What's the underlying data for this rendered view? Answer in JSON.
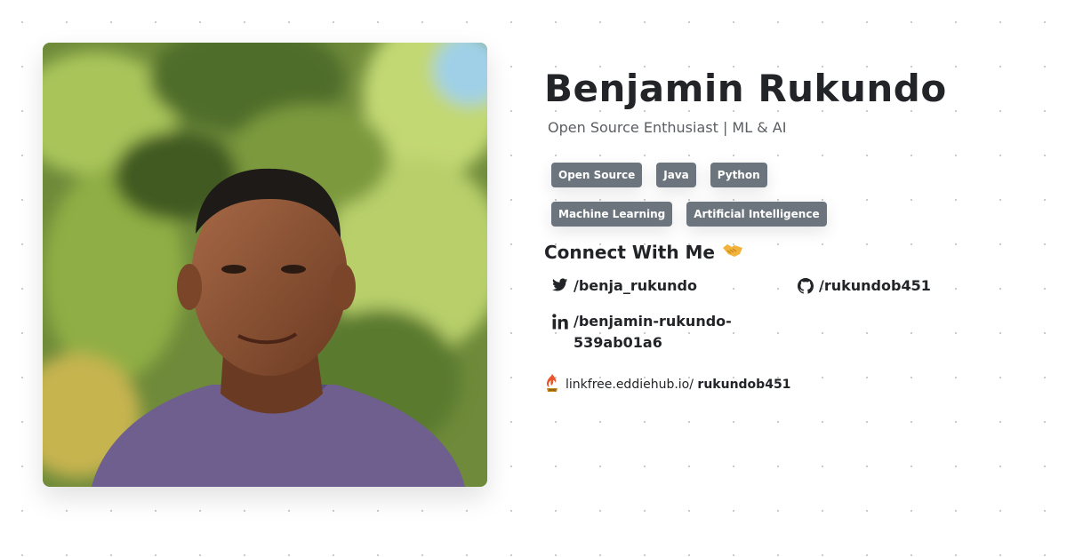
{
  "profile": {
    "name": "Benjamin Rukundo",
    "tagline": "Open Source Enthusiast | ML & AI",
    "photo_icon": "profile-photo"
  },
  "tags": {
    "row1": [
      "Open Source",
      "Java",
      "Python"
    ],
    "row2": [
      "Machine Learning",
      "Artificial Intelligence"
    ]
  },
  "connect": {
    "title": "Connect With Me",
    "title_icon": "handshake-icon",
    "twitter": "/benja_rukundo",
    "github": "/rukundob451",
    "linkedin": "/benjamin-rukundo-539ab01a6"
  },
  "linkfree": {
    "icon": "linkfree-logo-icon",
    "prefix": "linkfree.eddiehub.io/",
    "handle": "rukundob451"
  },
  "colors": {
    "tag_bg": "#6c757d",
    "text": "#222428",
    "muted": "#5a5d62"
  }
}
